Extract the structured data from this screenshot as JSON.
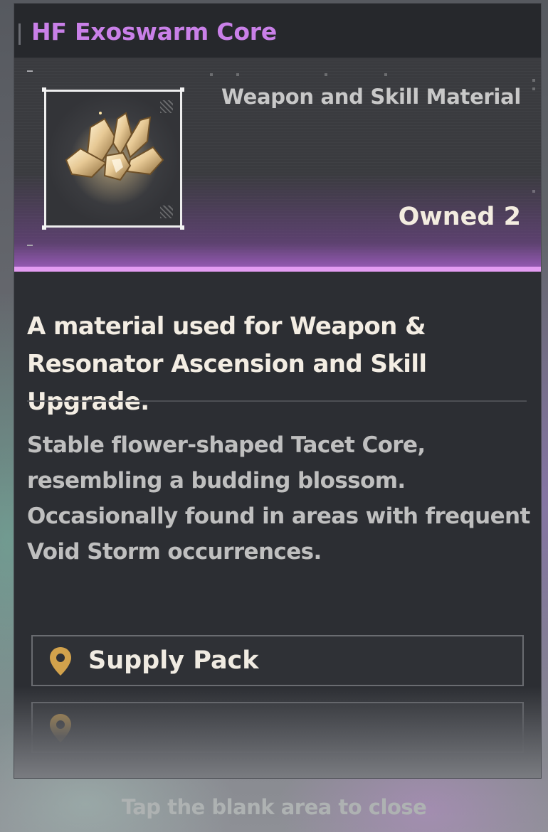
{
  "window": {
    "title": "HF Exoswarm Core"
  },
  "header": {
    "category": "Weapon and Skill Material",
    "owned_label": "Owned 2",
    "item_icon": "exoswarm-core-crystal-icon"
  },
  "body": {
    "summary": "A material used for Weapon & Resonator Ascension and Skill Upgrade.",
    "description_lines": [
      "Stable flower-shaped Tacet Core,",
      "resembling a budding blossom.",
      "Occasionally found in areas with frequent",
      "Void Storm occurrences."
    ]
  },
  "sources": [
    {
      "label": "Supply Pack",
      "icon": "location-pin-icon"
    },
    {
      "label": "",
      "icon": "location-pin-icon"
    }
  ],
  "footer": {
    "close_hint": "Tap the blank area to close"
  },
  "colors": {
    "title": "#c980e8",
    "accent_stripe": "#e39cf2",
    "pin": "#d2a24c",
    "owned_text": "#f3ece0"
  }
}
